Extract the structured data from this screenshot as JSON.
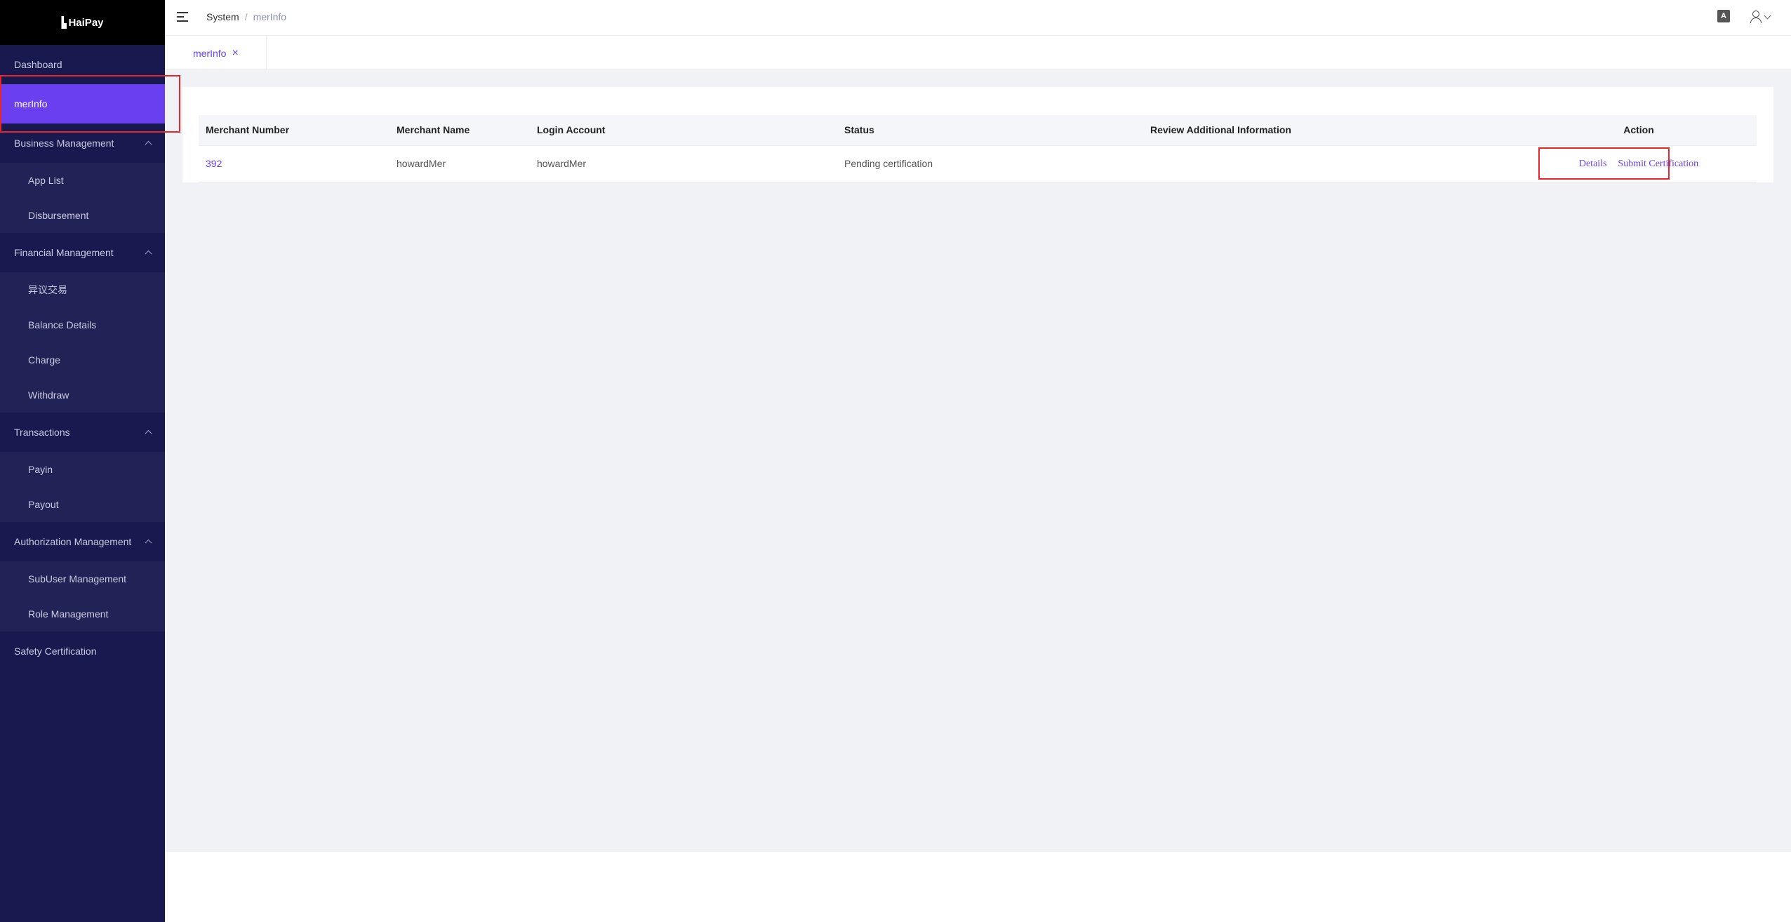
{
  "app": {
    "name": "HaiPay"
  },
  "sidebar": {
    "items": [
      {
        "label": "Dashboard",
        "type": "top"
      },
      {
        "label": "merInfo",
        "type": "top",
        "active": true
      },
      {
        "label": "Business Management",
        "type": "group"
      },
      {
        "label": "App List",
        "type": "sub"
      },
      {
        "label": "Disbursement",
        "type": "sub"
      },
      {
        "label": "Financial Management",
        "type": "group"
      },
      {
        "label": "异议交易",
        "type": "sub"
      },
      {
        "label": "Balance Details",
        "type": "sub"
      },
      {
        "label": "Charge",
        "type": "sub"
      },
      {
        "label": "Withdraw",
        "type": "sub"
      },
      {
        "label": "Transactions",
        "type": "group"
      },
      {
        "label": "Payin",
        "type": "sub"
      },
      {
        "label": "Payout",
        "type": "sub"
      },
      {
        "label": "Authorization Management",
        "type": "group"
      },
      {
        "label": "SubUser Management",
        "type": "sub"
      },
      {
        "label": "Role Management",
        "type": "sub"
      },
      {
        "label": "Safety Certification",
        "type": "top"
      }
    ]
  },
  "header": {
    "breadcrumb": [
      "System",
      "merInfo"
    ],
    "breadcrumb_sep": "/",
    "lang_icon_text": "A"
  },
  "tabs": [
    {
      "label": "merInfo",
      "close": "×"
    }
  ],
  "table": {
    "columns": [
      "Merchant Number",
      "Merchant Name",
      "Login Account",
      "Status",
      "Review Additional Information",
      "Action"
    ],
    "rows": [
      {
        "merchant_number": "392",
        "merchant_name": "howardMer",
        "login_account": "howardMer",
        "status": "Pending certification",
        "review_info": "",
        "actions": [
          "Details",
          "Submit Certification"
        ]
      }
    ]
  },
  "colors": {
    "sidebar_bg": "#17194f",
    "accent": "#6a3ff0",
    "highlight": "#e8262c"
  }
}
